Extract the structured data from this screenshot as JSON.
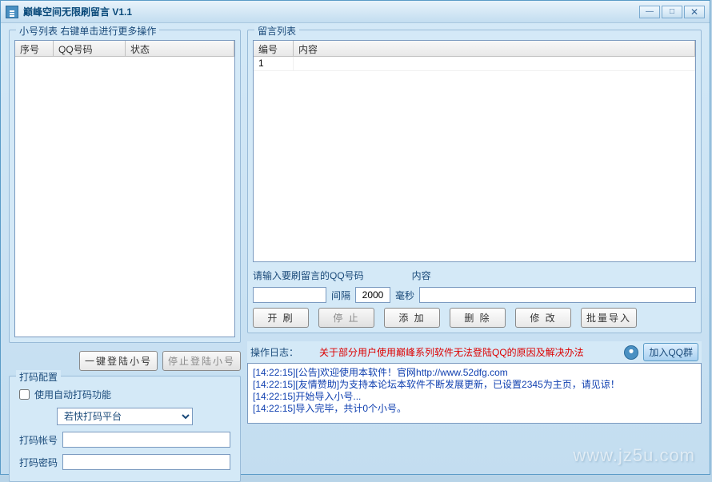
{
  "title": "巅峰空间无限刷留言 V1.1",
  "win_controls": {
    "min": "—",
    "max": "□",
    "close": "✕"
  },
  "left": {
    "group_title": "小号列表  右键单击进行更多操作",
    "cols": {
      "idx": "序号",
      "qq": "QQ号码",
      "status": "状态"
    },
    "one_key_login": "一键登陆小号",
    "stop_login": "停止登陆小号"
  },
  "dama": {
    "group_title": "打码配置",
    "auto_label": "使用自动打码功能",
    "platform_selected": "若快打码平台",
    "acct_label": "打码帐号",
    "pwd_label": "打码密码"
  },
  "right": {
    "msg_group_title": "留言列表",
    "cols": {
      "idx": "编号",
      "content": "内容"
    },
    "rows": [
      {
        "idx": "1",
        "content": ""
      }
    ],
    "qq_label": "请输入要刷留言的QQ号码",
    "content_label": "内容",
    "interval_label": "间隔",
    "interval_value": "2000",
    "ms_label": "毫秒",
    "buttons": {
      "start": "开 刷",
      "stop": "停 止",
      "add": "添 加",
      "delete": "删 除",
      "modify": "修 改",
      "batch_import": "批量导入"
    }
  },
  "log": {
    "label": "操作日志：",
    "notice": "关于部分用户使用巅峰系列软件无法登陆QQ的原因及解决办法",
    "join_group": "加入QQ群",
    "lines": [
      "[14:22:15][公告]欢迎使用本软件！官网http://www.52dfg.com",
      "[14:22:15][友情赞助]为支持本论坛本软件不断发展更新，已设置2345为主页，请见谅！",
      "[14:22:15]开始导入小号...",
      "[14:22:15]导入完毕，共计0个小号。"
    ]
  },
  "watermark": "www.jz5u.com"
}
